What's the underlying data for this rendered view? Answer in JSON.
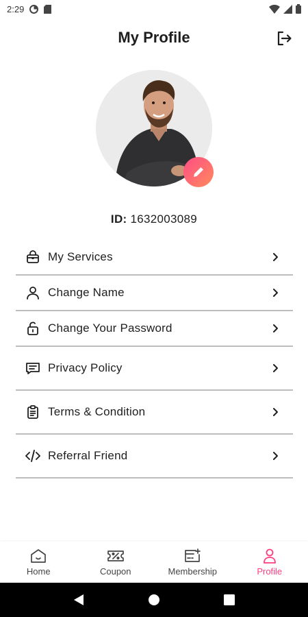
{
  "status_bar": {
    "time": "2:29"
  },
  "header": {
    "title": "My Profile"
  },
  "profile": {
    "id_label": "ID:",
    "id_value": "1632003089"
  },
  "menu": {
    "items": [
      {
        "label": "My Services",
        "icon": "lock-bag-icon"
      },
      {
        "label": "Change Name",
        "icon": "user-icon"
      },
      {
        "label": "Change Your Password",
        "icon": "unlock-icon"
      },
      {
        "label": "Privacy Policy",
        "icon": "message-icon"
      },
      {
        "label": "Terms & Condition",
        "icon": "clipboard-icon"
      },
      {
        "label": "Referral Friend",
        "icon": "code-icon"
      }
    ]
  },
  "bottom_nav": {
    "items": [
      {
        "label": "Home",
        "icon": "home-icon"
      },
      {
        "label": "Coupon",
        "icon": "coupon-icon"
      },
      {
        "label": "Membership",
        "icon": "membership-card-icon"
      },
      {
        "label": "Profile",
        "icon": "profile-icon",
        "active": true
      }
    ]
  },
  "colors": {
    "accent": "#ff3d7f",
    "gradient_start": "#ff4d86",
    "gradient_end": "#ff8a5c",
    "divider": "#bdbdbd"
  }
}
